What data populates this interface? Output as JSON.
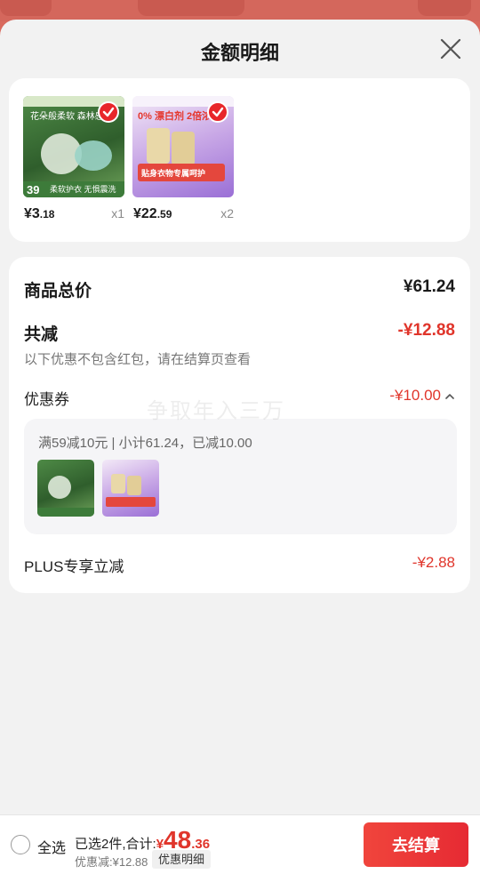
{
  "sheet": {
    "title": "金额明细"
  },
  "products": [
    {
      "price_int": "¥3",
      "price_dec": ".18",
      "qty": "x1",
      "image_label_top": "花朵般柔软 森林感",
      "image_label_bottom": "柔软护衣 无惧震洗",
      "image_label_num": "39"
    },
    {
      "price_int": "¥22",
      "price_dec": ".59",
      "qty": "x2",
      "image_label_top": "0% 漂白剂 2倍浓",
      "image_label_bottom": "贴身衣物专属呵护"
    }
  ],
  "summary": {
    "total_label": "商品总价",
    "total_value": "¥61.24",
    "reduce_label": "共减",
    "reduce_value": "-¥12.88",
    "reduce_note": "以下优惠不包含红包，请在结算页查看",
    "coupon_label": "优惠券",
    "coupon_value": "-¥10.00",
    "coupon_rule": "满59减10元 | 小计61.24，已减10.00",
    "plus_label": "PLUS专享立减",
    "plus_value": "-¥2.88"
  },
  "watermark": "争取年入三万",
  "bottom_bar": {
    "select_all": "全选",
    "selected_text": "已选2件,合计:",
    "total_symbol": "¥",
    "total_int": "48",
    "total_dec": ".36",
    "discount_text": "优惠减:¥12.88",
    "detail_chip": "优惠明细",
    "checkout": "去结算"
  },
  "colors": {
    "accent_red": "#e0352b",
    "button_red": "#e62a33"
  }
}
